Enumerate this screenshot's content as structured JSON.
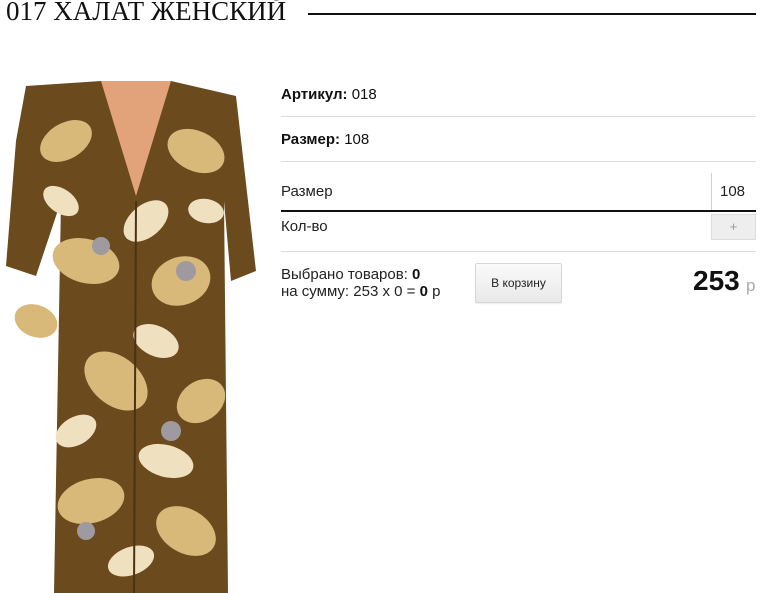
{
  "product": {
    "title": "017 ХАЛАТ ЖЕНСКИЙ",
    "article_label": "Артикул:",
    "article_value": "018",
    "size_label": "Размер:",
    "size_value": "108"
  },
  "options": {
    "size_label": "Размер",
    "size_value": "108",
    "qty_label": "Кол-во",
    "plus_label": "+"
  },
  "summary": {
    "selected_label": "Выбрано товаров:",
    "selected_count": "0",
    "sum_label": "на сумму: 253 x 0 =",
    "sum_value": "0",
    "sum_currency": "р"
  },
  "cart": {
    "button_label": "В корзину"
  },
  "price": {
    "value": "253",
    "currency": "р"
  },
  "colors": {
    "dress_base": "#6b4a1e",
    "dress_leaf": "#d8b97a",
    "dress_light": "#efe1bf"
  },
  "icons": {
    "plus": "plus-icon"
  }
}
